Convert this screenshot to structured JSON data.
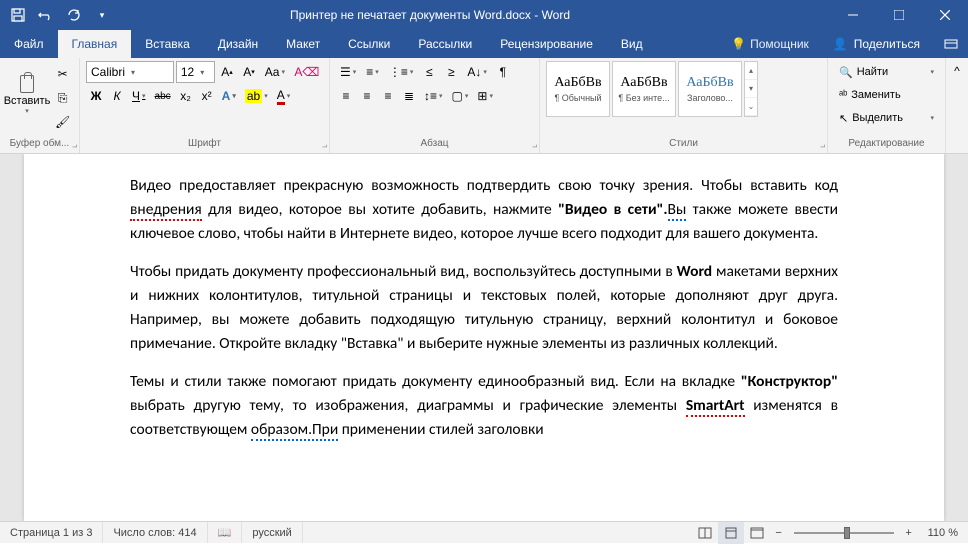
{
  "title": "Принтер не печатает документы Word.docx - Word",
  "tabs": [
    "Файл",
    "Главная",
    "Вставка",
    "Дизайн",
    "Макет",
    "Ссылки",
    "Рассылки",
    "Рецензирование",
    "Вид"
  ],
  "help": "Помощник",
  "share": "Поделиться",
  "ribbon": {
    "clipboard": {
      "label": "Буфер обм...",
      "paste": "Вставить"
    },
    "font": {
      "label": "Шрифт",
      "name": "Calibri",
      "size": "12",
      "bold": "Ж",
      "italic": "К",
      "underline": "Ч",
      "strike": "abc",
      "sub": "x₂",
      "sup": "x²",
      "clear": "Aa"
    },
    "paragraph": {
      "label": "Абзац"
    },
    "styles": {
      "label": "Стили",
      "items": [
        {
          "prev": "АаБбВв",
          "name": "¶ Обычный"
        },
        {
          "prev": "АаБбВв",
          "name": "¶ Без инте..."
        },
        {
          "prev": "АаБбВв",
          "name": "Заголово...",
          "color": "#2e74b5"
        }
      ]
    },
    "editing": {
      "label": "Редактирование",
      "find": "Найти",
      "replace": "Заменить",
      "select": "Выделить"
    }
  },
  "document": {
    "p1a": "Видео предоставляет прекрасную возможность подтвердить свою точку зрения. Чтобы вставить код ",
    "p1b": "внедрения",
    "p1c": " для видео, которое вы хотите добавить, нажмите ",
    "p1d": "\"Видео в сети\".",
    "p1e": "Вы",
    "p1f": " также можете ввести ключевое слово, чтобы найти в Интернете видео, которое лучше всего подходит для вашего документа.",
    "p2a": "Чтобы придать документу профессиональный вид, воспользуйтесь доступными в ",
    "p2b": "Word",
    "p2c": " макетами верхних и нижних колонтитулов, титульной страницы и текстовых полей, которые дополняют друг друга. Например, вы можете добавить подходящую титульную страницу, верхний колонтитул и боковое примечание. Откройте вкладку \"Вставка\" и выберите нужные элементы из различных коллекций.",
    "p3a": "Темы и стили также помогают придать документу единообразный вид. Если на вкладке ",
    "p3b": "\"Конструктор\"",
    "p3c": " выбрать другую тему, то изображения, диаграммы и графические элементы ",
    "p3d": "SmartArt",
    "p3e": " изменятся в соответствующем ",
    "p3f": "образом.При",
    "p3g": " применении стилей заголовки"
  },
  "status": {
    "page": "Страница 1 из 3",
    "words": "Число слов: 414",
    "lang": "русский",
    "zoom": "110 %"
  }
}
